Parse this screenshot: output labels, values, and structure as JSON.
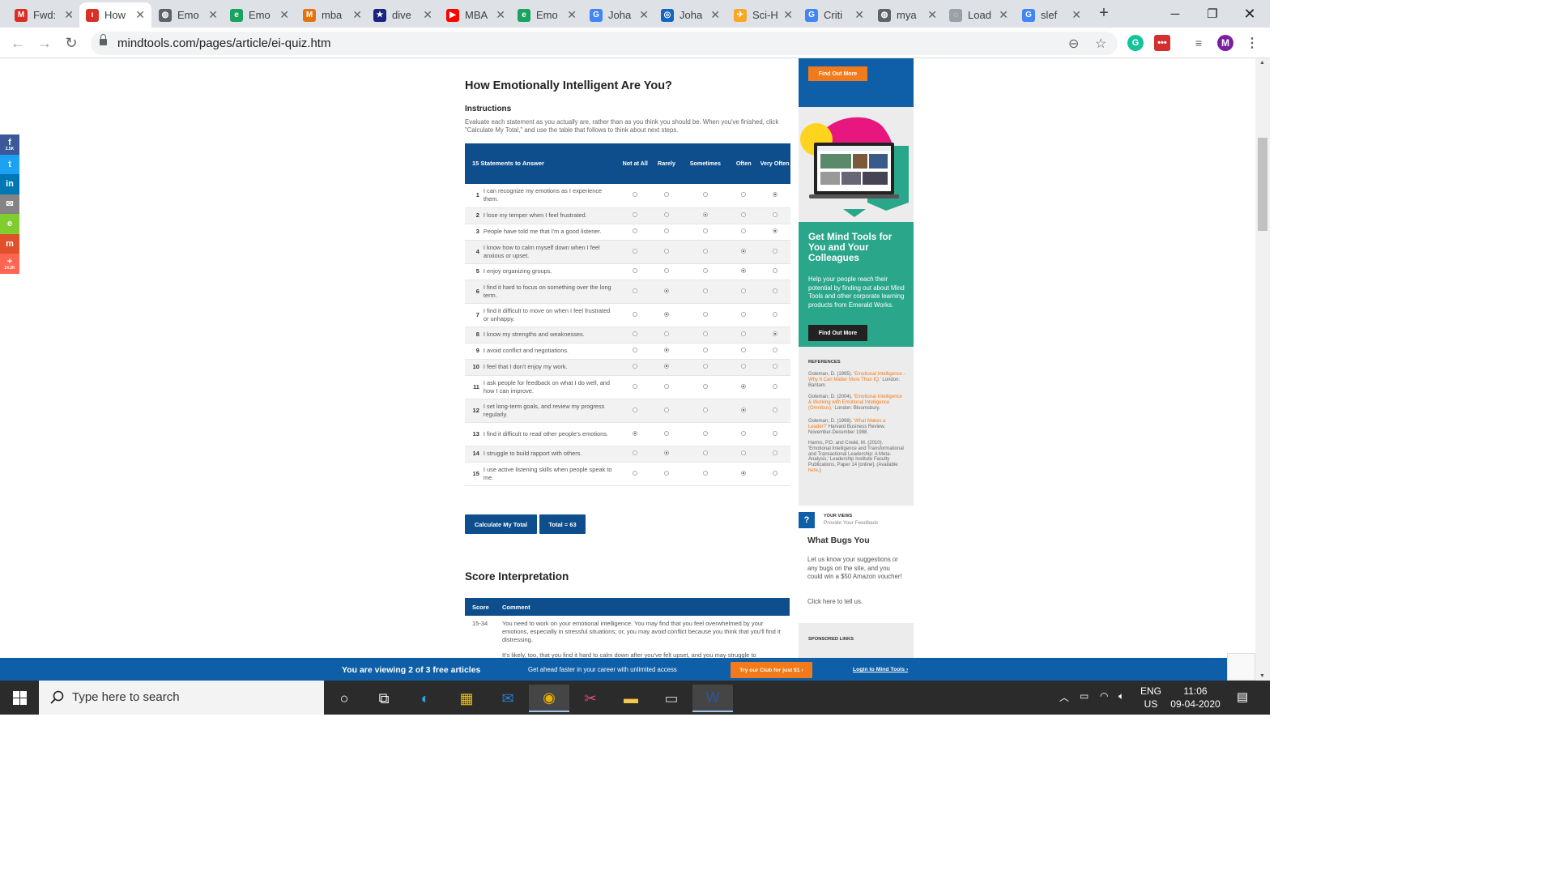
{
  "browser": {
    "tabs": [
      {
        "title": "Fwd:",
        "color": "#d93025",
        "glyph": "M"
      },
      {
        "title": "How",
        "color": "#d93025",
        "glyph": "ı",
        "active": true
      },
      {
        "title": "Emo",
        "color": "#5f6368",
        "glyph": "◍"
      },
      {
        "title": "Emo",
        "color": "#1aa260",
        "glyph": "e"
      },
      {
        "title": "mba",
        "color": "#e8710a",
        "glyph": "M"
      },
      {
        "title": "dive",
        "color": "#1a237e",
        "glyph": "★"
      },
      {
        "title": "MBA",
        "color": "#ff0000",
        "glyph": "▶"
      },
      {
        "title": "Emo",
        "color": "#1aa260",
        "glyph": "e"
      },
      {
        "title": "Joha",
        "color": "#4285f4",
        "glyph": "G"
      },
      {
        "title": "Joha",
        "color": "#1565c0",
        "glyph": "◎"
      },
      {
        "title": "Sci-H",
        "color": "#f9a825",
        "glyph": "✈"
      },
      {
        "title": "Criti",
        "color": "#4285f4",
        "glyph": "G"
      },
      {
        "title": "mya",
        "color": "#5f6368",
        "glyph": "◍"
      },
      {
        "title": "Load",
        "color": "#9aa0a6",
        "glyph": "◌"
      },
      {
        "title": "slef",
        "color": "#4285f4",
        "glyph": "G"
      }
    ],
    "url": "mindtools.com/pages/article/ei-quiz.htm",
    "profile_initial": "M"
  },
  "share": [
    {
      "glyph": "f",
      "count": "2.5K",
      "color": "#3b5998"
    },
    {
      "glyph": "t",
      "count": "",
      "color": "#1da1f2"
    },
    {
      "glyph": "in",
      "count": "",
      "color": "#0077b5"
    },
    {
      "glyph": "✉",
      "count": "",
      "color": "#848484"
    },
    {
      "glyph": "e",
      "count": "",
      "color": "#7fce2e"
    },
    {
      "glyph": "m",
      "count": "",
      "color": "#e0502a"
    },
    {
      "glyph": "+",
      "count": "14.3K",
      "color": "#ff6550"
    }
  ],
  "article": {
    "title": "How Emotionally Intelligent Are You?",
    "instructions_heading": "Instructions",
    "instructions": "Evaluate each statement as you actually are, rather than as you think you should be. When you've finished, click \"Calculate My Total,\" and use the table that follows to think about next steps.",
    "quiz_header": "15 Statements to Answer",
    "options": [
      "Not at All",
      "Rarely",
      "Sometimes",
      "Often",
      "Very Often"
    ],
    "statements": [
      {
        "n": "1",
        "text": "I can recognize my emotions as I experience them.",
        "sel": 4
      },
      {
        "n": "2",
        "text": "I lose my temper when I feel frustrated.",
        "sel": 2
      },
      {
        "n": "3",
        "text": "People have told me that I'm a good listener.",
        "sel": 4
      },
      {
        "n": "4",
        "text": "I know how to calm myself down when I feel anxious or upset.",
        "sel": 3
      },
      {
        "n": "5",
        "text": "I enjoy organizing groups.",
        "sel": 3
      },
      {
        "n": "6",
        "text": "I find it hard to focus on something over the long term.",
        "sel": 1
      },
      {
        "n": "7",
        "text": "I find it difficult to move on when I feel frustrated or unhappy.",
        "sel": 1
      },
      {
        "n": "8",
        "text": "I know my strengths and weaknesses.",
        "sel": 4
      },
      {
        "n": "9",
        "text": "I avoid conflict and negotiations.",
        "sel": 1
      },
      {
        "n": "10",
        "text": "I feel that I don't enjoy my work.",
        "sel": 1
      },
      {
        "n": "11",
        "text": "I ask people for feedback on what I do well, and how I can improve.",
        "sel": 3
      },
      {
        "n": "12",
        "text": "I set long-term goals, and review my progress regularly.",
        "sel": 3
      },
      {
        "n": "13",
        "text": "I find it difficult to read other people's emotions.",
        "sel": 0
      },
      {
        "n": "14",
        "text": "I struggle to build rapport with others.",
        "sel": 1
      },
      {
        "n": "15",
        "text": "I use active listening skills when people speak to me.",
        "sel": 3
      }
    ],
    "calc_button": "Calculate My Total",
    "total": "Total = 63",
    "score_title": "Score Interpretation",
    "score_cols": [
      "Score",
      "Comment"
    ],
    "score_row": {
      "score": "15-34",
      "comment": "You need to work on your emotional intelligence. You may find that you feel overwhelmed by your emotions, especially in stressful situations; or, you may avoid conflict because you think that you'll find it distressing.",
      "comment2": "It's likely, too, that you find it hard to calm down after you've felt upset, and you may struggle to"
    }
  },
  "sidebar": {
    "find_out_more_1": "Find Out More",
    "promo_title": "Get Mind Tools for You and Your Colleagues",
    "promo_text": "Help your people reach their potential by finding out about Mind Tools and other corporate learning products from Emerald Works.",
    "find_out_more_2": "Find Out More",
    "refs_heading": "REFERENCES",
    "refs": [
      {
        "a": "Goleman, D. (1995). ",
        "t": "'Emotional Intelligence - Why It Can Matter More Than IQ.'",
        "b": " London: Bantam."
      },
      {
        "a": "Goleman, D. (2004). ",
        "t": "'Emotional Intelligence & Working with Emotional Intelligence (Omnibus),'",
        "b": " London: Bloomsbury."
      },
      {
        "a": "Goleman, D. (1998). ",
        "t": "'What Makes a Leader?'",
        "b": " Harvard Business Review, November-December 1998."
      },
      {
        "a": "Harms, P.D. and Credé, M. (2010). 'Emotional Intelligence and Transformational and Transactional Leadership: A Meta-Analysis,' Leadership Institute Faculty Publications, Paper 14 [online]. (Available ",
        "t": "here",
        "b": ".)"
      }
    ],
    "views_label": "YOUR VIEWS",
    "views_sub": "Provide Your Feedback",
    "views_title": "What Bugs You",
    "views_text": "Let us know your suggestions or any bugs on the site, and you could win a $50 Amazon voucher!",
    "views_click": "Click here to tell us.",
    "sponsored": "SPONSORED LINKS"
  },
  "banner": {
    "viewing": "You are viewing 2 of 3 free articles",
    "ahead": "Get ahead faster in your career with unlimited access",
    "try": "Try our Club for just $1 ›",
    "login": "Login to Mind Tools ›"
  },
  "taskbar": {
    "search_placeholder": "Type here to search",
    "lang1": "ENG",
    "lang2": "US",
    "time": "11:06",
    "date": "09-04-2020"
  }
}
